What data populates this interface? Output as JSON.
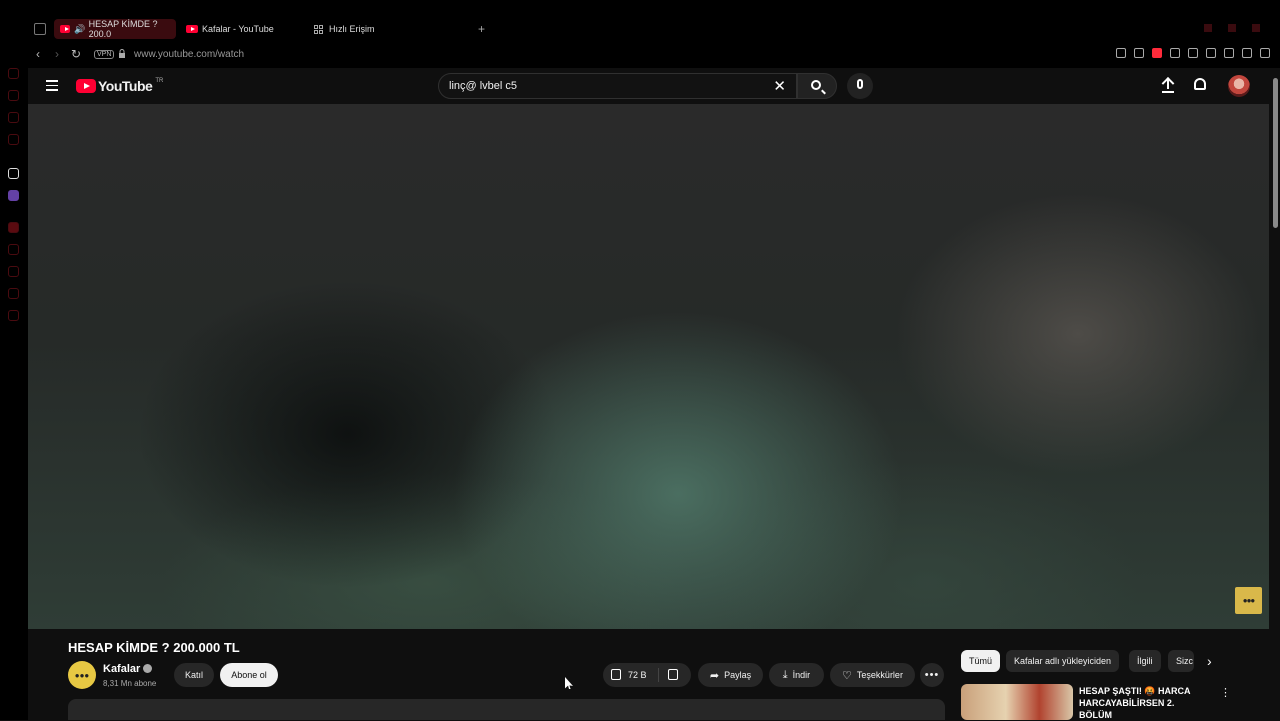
{
  "browser": {
    "tabs": [
      {
        "label": "HESAP KİMDE ? 200.0",
        "active": true
      },
      {
        "label": "Kafalar - YouTube",
        "active": false
      },
      {
        "label": "Hızlı Erişim",
        "active": false
      }
    ],
    "new_tab_symbol": "+",
    "vpn_badge": "VPN",
    "url": "www.youtube.com/watch",
    "back_symbol": "‹",
    "forward_symbol": "›",
    "reload_symbol": "↻"
  },
  "header": {
    "logo_text": "YouTube",
    "country_code": "TR",
    "search_query": "linç@ lvbel c5",
    "clear_symbol": "✕",
    "icons": [
      "menu-icon",
      "search-icon",
      "mic-icon",
      "upload-icon",
      "bell-icon",
      "avatar"
    ]
  },
  "video": {
    "title": "HESAP KİMDE ? 200.000 TL",
    "channel_name": "Kafalar",
    "subscribers": "8,31 Mn abone",
    "join_label": "Katıl",
    "subscribe_label": "Abone ol",
    "likes": "72 B",
    "share_label": "Paylaş",
    "download_label": "İndir",
    "thanks_label": "Teşekkürler",
    "more_symbol": "•••"
  },
  "sidebar_chips": [
    "Tümü",
    "Kafalar adlı yükleyiciden",
    "İlgili",
    "Sizc"
  ],
  "recommendation": {
    "title": "HESAP ŞAŞTI! 🤬 HARCA HARCAYABİLİRSEN 2. BÖLÜM",
    "menu_symbol": "⋮"
  },
  "colors": {
    "brand_red": "#ff0033",
    "background": "#0f0f0f",
    "button_bg": "#272727"
  }
}
